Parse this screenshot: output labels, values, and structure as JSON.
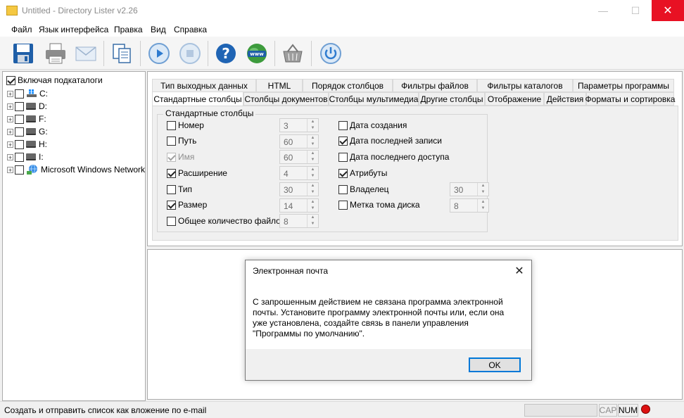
{
  "window": {
    "title": "Untitled - Directory Lister v2.26",
    "close_glyph": "✕",
    "minimize_glyph": "—",
    "maximize_glyph": "☐"
  },
  "menu": [
    "Файл",
    "Язык интерфейса",
    "Правка",
    "Вид",
    "Справка"
  ],
  "toolbar": {
    "buttons": [
      "save-icon",
      "print-icon",
      "email-icon",
      "copy-icon",
      "play-icon",
      "stop-icon",
      "help-icon",
      "web-icon",
      "basket-icon",
      "power-icon"
    ]
  },
  "tree": {
    "root_label": "Включая подкаталоги",
    "items": [
      {
        "label": "C:",
        "icon": "windows-drive-icon"
      },
      {
        "label": "D:",
        "icon": "drive-icon"
      },
      {
        "label": "F:",
        "icon": "drive-icon"
      },
      {
        "label": "G:",
        "icon": "drive-icon"
      },
      {
        "label": "H:",
        "icon": "drive-icon"
      },
      {
        "label": "I:",
        "icon": "drive-icon"
      },
      {
        "label": "Microsoft Windows Network",
        "icon": "network-icon"
      }
    ]
  },
  "tabs": {
    "row1": [
      "Тип выходных данных",
      "HTML",
      "Порядок столбцов",
      "Фильтры файлов",
      "Фильтры каталогов",
      "Параметры программы"
    ],
    "row2": [
      "Стандартные столбцы",
      "Столбцы документов",
      "Столбцы мультимедиа",
      "Другие столбцы",
      "Отображение",
      "Действия",
      "Форматы и сортировка"
    ],
    "active": "Стандартные столбцы"
  },
  "standard_columns": {
    "group_label": "Стандартные столбцы",
    "left": [
      {
        "label": "Номер",
        "checked": false,
        "disabled": false,
        "value": "3"
      },
      {
        "label": "Путь",
        "checked": false,
        "disabled": false,
        "value": "60"
      },
      {
        "label": "Имя",
        "checked": true,
        "disabled": true,
        "value": "60"
      },
      {
        "label": "Расширение",
        "checked": true,
        "disabled": false,
        "value": "4"
      },
      {
        "label": "Тип",
        "checked": false,
        "disabled": false,
        "value": "30"
      },
      {
        "label": "Размер",
        "checked": true,
        "disabled": false,
        "value": "14"
      },
      {
        "label": "Общее количество файлов",
        "checked": false,
        "disabled": false,
        "value": "8"
      }
    ],
    "right": [
      {
        "label": "Дата создания",
        "checked": false
      },
      {
        "label": "Дата последней записи",
        "checked": true
      },
      {
        "label": "Дата последнего доступа",
        "checked": false
      },
      {
        "label": "Атрибуты",
        "checked": true
      },
      {
        "label": "Владелец",
        "checked": false,
        "value": "30"
      },
      {
        "label": "Метка тома диска",
        "checked": false,
        "value": "8"
      }
    ]
  },
  "dialog": {
    "title": "Электронная почта",
    "message": "С запрошенным действием не связана программа электронной почты. Установите программу электронной почты или, если она уже установлена, создайте связь в панели управления \"Программы по умолчанию\".",
    "ok_label": "OK"
  },
  "status": {
    "text": "Создать и отправить список как вложение по e-mail",
    "cap": "CAP",
    "num": "NUM"
  }
}
